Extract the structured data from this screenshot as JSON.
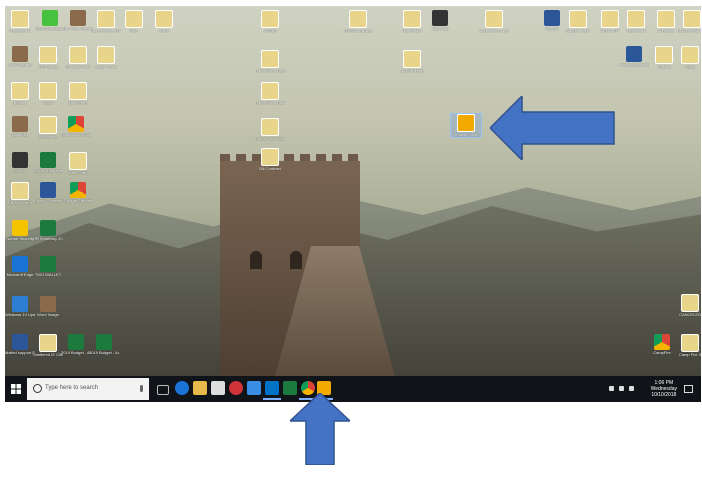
{
  "desktop": {
    "icons": [
      {
        "label": "Recycle Bin",
        "glyph": "file"
      },
      {
        "label": "WSUS/ConfigMgr",
        "glyph": "green"
      },
      {
        "label": "HP Photo Creations",
        "glyph": "photo"
      },
      {
        "label": "Tax Preview Setup",
        "glyph": "file"
      },
      {
        "label": "PDF",
        "glyph": "file"
      },
      {
        "label": "USUK",
        "glyph": "file"
      },
      {
        "label": "AAR09",
        "glyph": "file"
      },
      {
        "label": "FAFSA Building",
        "glyph": "file"
      },
      {
        "label": "Mail Folder",
        "glyph": "file"
      },
      {
        "label": "Intel Mail",
        "glyph": "dark"
      },
      {
        "label": "Carbonite Home",
        "glyph": "file"
      },
      {
        "label": "dev.doc",
        "glyph": "word"
      },
      {
        "label": "Copper Court",
        "glyph": "file"
      },
      {
        "label": "CENTURY",
        "glyph": "file"
      },
      {
        "label": "High Bond",
        "glyph": "file"
      },
      {
        "label": "Windows",
        "glyph": "file"
      },
      {
        "label": "HEDO Bond Payment",
        "glyph": "file"
      },
      {
        "label": "Lido Returns",
        "glyph": "photo"
      },
      {
        "label": "IRS Return",
        "glyph": "file"
      },
      {
        "label": "Quicken Audit",
        "glyph": "file"
      },
      {
        "label": "Legal Forms",
        "glyph": "file"
      },
      {
        "label": "Home Town Debt Help",
        "glyph": "file"
      },
      {
        "label": "ALDI Budget",
        "glyph": "file"
      },
      {
        "label": "install application",
        "glyph": "word"
      },
      {
        "label": "Tooling",
        "glyph": "file"
      },
      {
        "label": "Apple",
        "glyph": "file"
      },
      {
        "label": "Budget",
        "glyph": "file"
      },
      {
        "label": "USDA",
        "glyph": "file"
      },
      {
        "label": "Medi-Fone",
        "glyph": "file"
      },
      {
        "label": "Home Town Budget",
        "glyph": "file"
      },
      {
        "label": "Home Town Water",
        "glyph": "file"
      },
      {
        "label": "Bill Contract",
        "glyph": "file"
      },
      {
        "label": "Amazon Audit",
        "glyph": "amazon"
      },
      {
        "label": "Calendar",
        "glyph": "photo"
      },
      {
        "label": "Shopping",
        "glyph": "file"
      },
      {
        "label": "Shortcut to Choice Edge",
        "glyph": "chrome"
      },
      {
        "label": "Bill Pay",
        "glyph": "dark"
      },
      {
        "label": "Excel Mortgage",
        "glyph": "xl"
      },
      {
        "label": "Intuit Form",
        "glyph": "file"
      },
      {
        "label": "Bill Pay Form",
        "glyph": "file"
      },
      {
        "label": "Equity Contract",
        "glyph": "word"
      },
      {
        "label": "Google Chrome",
        "glyph": "chrome"
      },
      {
        "label": "Norton Security",
        "glyph": "norton"
      },
      {
        "label": "HR Summary 2018",
        "glyph": "xl"
      },
      {
        "label": "Microsoft Edge",
        "glyph": "edge"
      },
      {
        "label": "TWO WALLET",
        "glyph": "xl"
      },
      {
        "label": "Windows 10 Update As...",
        "glyph": "win"
      },
      {
        "label": "Word Image",
        "glyph": "photo"
      },
      {
        "label": "Mailed support Excel PC",
        "glyph": "word"
      },
      {
        "label": "Sheltered IE Client Prin",
        "glyph": "file"
      },
      {
        "label": "2019 Budget - Actual Actu..",
        "glyph": "xl"
      },
      {
        "label": "2019 Budget - Actual Actual",
        "glyph": "xl"
      },
      {
        "label": "CANCELED",
        "glyph": "file"
      },
      {
        "label": "CampFire",
        "glyph": "chrome"
      },
      {
        "label": "Camp Fire 3",
        "glyph": "file"
      }
    ]
  },
  "taskbar": {
    "search_placeholder": "Type here to search",
    "apps": [
      "task-view",
      "edge",
      "file-explorer",
      "store",
      "mail",
      "photos",
      "outlook",
      "excel",
      "chrome",
      "amazon-audit"
    ],
    "clock_time": "1:06 PM",
    "clock_day": "Wednesday",
    "clock_date": "10/10/2018"
  },
  "annotations": {
    "arrow_color": "#4472c4"
  }
}
